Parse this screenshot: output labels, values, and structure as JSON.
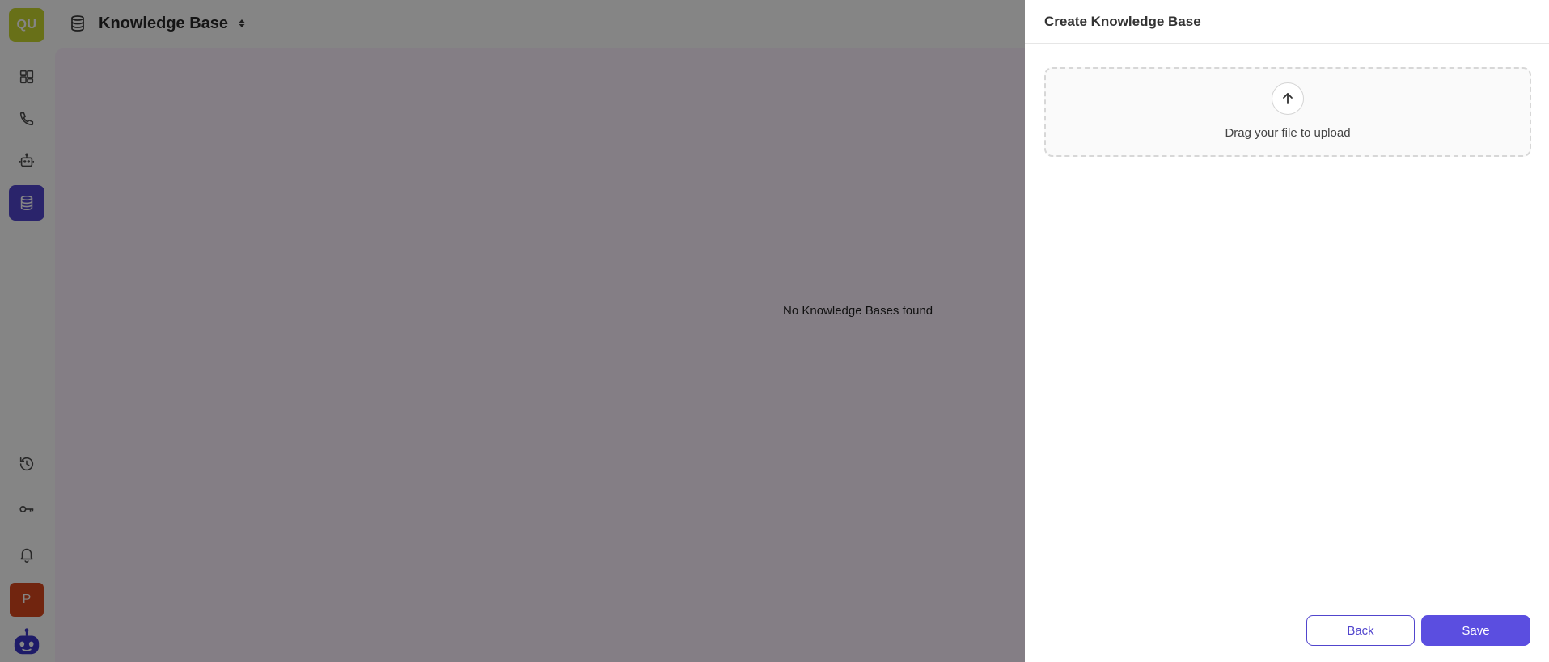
{
  "sidebar": {
    "workspace_initials": "QU",
    "profile_initial": "P",
    "nav_items": [
      {
        "name": "dashboard",
        "icon": "grid-icon"
      },
      {
        "name": "calls",
        "icon": "phone-icon"
      },
      {
        "name": "agents",
        "icon": "robot-icon"
      },
      {
        "name": "knowledge-base",
        "icon": "database-icon",
        "active": true
      }
    ],
    "bottom_items": [
      {
        "name": "history",
        "icon": "history-icon"
      },
      {
        "name": "api-keys",
        "icon": "key-icon"
      },
      {
        "name": "notifications",
        "icon": "bell-icon"
      }
    ]
  },
  "header": {
    "title": "Knowledge Base"
  },
  "main": {
    "empty_text": "No Knowledge Bases found"
  },
  "drawer": {
    "title": "Create Knowledge Base",
    "upload_text": "Drag your file to upload",
    "back_label": "Back",
    "save_label": "Save"
  },
  "colors": {
    "accent": "#5145cd",
    "workspace_badge": "#c7d62f",
    "profile_badge": "#d9481e"
  }
}
